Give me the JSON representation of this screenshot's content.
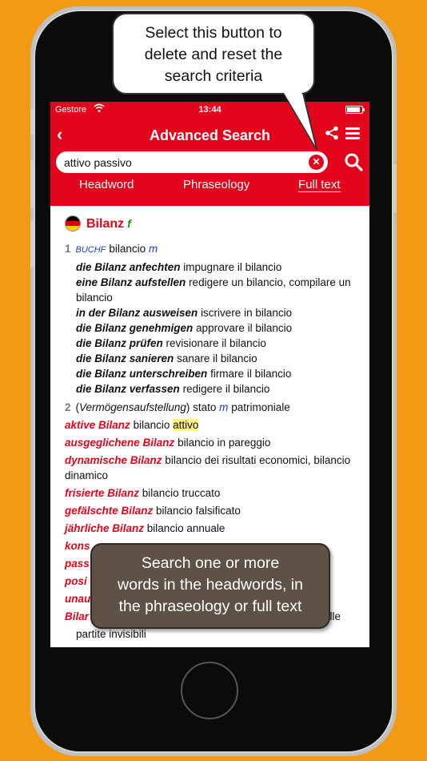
{
  "status_bar": {
    "carrier": "Gestore",
    "time": "13:44",
    "battery_level": 0.9
  },
  "app_bar": {
    "back_label": "‹",
    "title": "Advanced Search"
  },
  "search": {
    "value": "attivo passivo",
    "clear_label": "✕"
  },
  "tabs": [
    {
      "label": "Headword",
      "active": false
    },
    {
      "label": "Phraseology",
      "active": false
    },
    {
      "label": "Full text",
      "active": true
    }
  ],
  "entry": {
    "headword": "Bilanz",
    "gender": "f",
    "sense1": {
      "num": "1",
      "domain": "BUCHF",
      "translation": "bilancio",
      "gender": "m",
      "phrases": [
        {
          "de": "die Bilanz anfechten",
          "it": "impugnare il bilancio"
        },
        {
          "de": "eine Bilanz aufstellen",
          "it": "redigere un bilancio, compilare un bilancio"
        },
        {
          "de": "in der Bilanz ausweisen",
          "it": "iscrivere in bilancio"
        },
        {
          "de": "die Bilanz genehmigen",
          "it": "approvare il bilancio"
        },
        {
          "de": "die Bilanz prüfen",
          "it": "revisionare il bilancio"
        },
        {
          "de": "die Bilanz sanieren",
          "it": "sanare il bilancio"
        },
        {
          "de": "die Bilanz unterschreiben",
          "it": "firmare il bilancio"
        },
        {
          "de": "die Bilanz verfassen",
          "it": "redigere il bilancio"
        }
      ]
    },
    "sense2": {
      "num": "2",
      "paren_open": "(",
      "context": "Vermögensaufstellung",
      "paren_close": ")",
      "translation_a": "stato",
      "gender": "m",
      "translation_b": "patrimoniale"
    },
    "compounds": [
      {
        "de": "aktive Bilanz",
        "it_pre": "bilancio",
        "it_hl": "attivo"
      },
      {
        "de": "ausgeglichene Bilanz",
        "it": "bilancio in pareggio"
      },
      {
        "de": "dynamische Bilanz",
        "it": "bilancio dei risultati economici, bilancio dinamico"
      },
      {
        "de": "frisierte Bilanz",
        "it": "bilancio truccato"
      },
      {
        "de": "gefälschte Bilanz",
        "it": "bilancio falsificato"
      },
      {
        "de": "jährliche Bilanz",
        "it": "bilancio annuale"
      }
    ],
    "hidden_fragments": [
      {
        "de": "kons"
      },
      {
        "de": "pass"
      },
      {
        "de": "posi"
      },
      {
        "de": "unau"
      },
      {
        "de": "Bilar",
        "it": "elle"
      }
    ],
    "trailing_line": "partite invisibili"
  },
  "callouts": {
    "top": [
      "Select this button to",
      "delete and reset the",
      "search criteria"
    ],
    "bottom": [
      "Search one or more",
      "words in the headwords, in",
      "the phraseology or full text"
    ]
  },
  "colors": {
    "brand_red": "#E3051B",
    "background_orange": "#F39A14",
    "callout_brown": "#5E5246"
  }
}
